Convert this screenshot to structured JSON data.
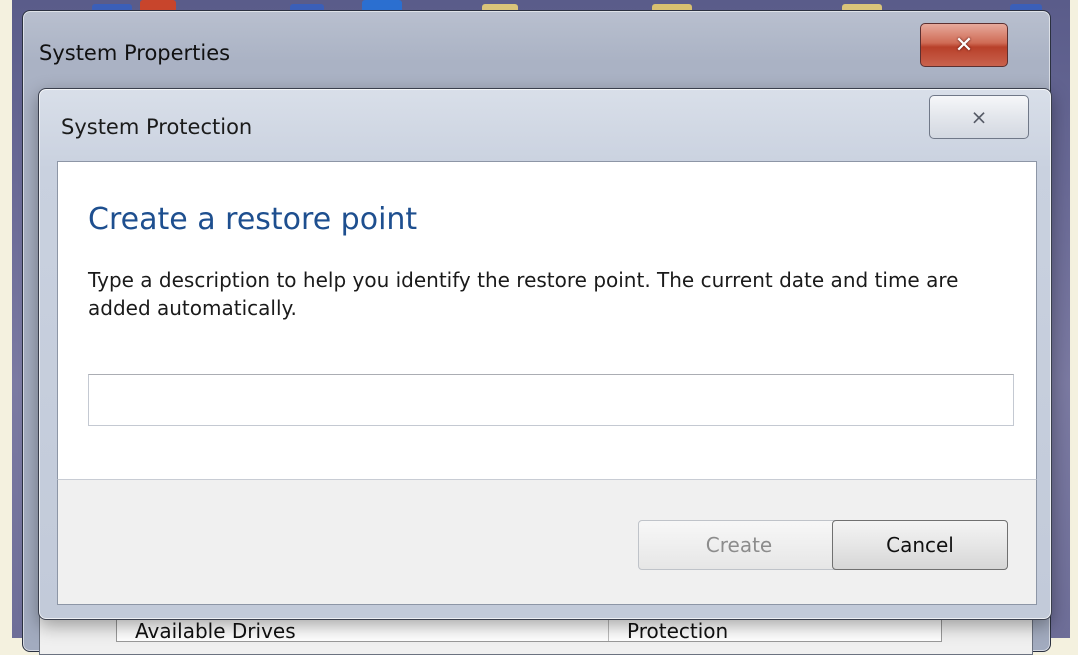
{
  "background_window": {
    "title": "System Properties",
    "close_glyph": "✕",
    "table_columns": [
      "Available Drives",
      "Protection"
    ]
  },
  "dialog": {
    "title": "System Protection",
    "close_glyph": "⨯",
    "heading": "Create a restore point",
    "description": "Type a description to help you identify the restore point. The current date and time are added automatically.",
    "input": {
      "value": "",
      "placeholder": ""
    },
    "buttons": {
      "create": "Create",
      "cancel": "Cancel"
    }
  },
  "colors": {
    "heading": "#1e4f8f",
    "close_button_red": "#c9624d"
  }
}
